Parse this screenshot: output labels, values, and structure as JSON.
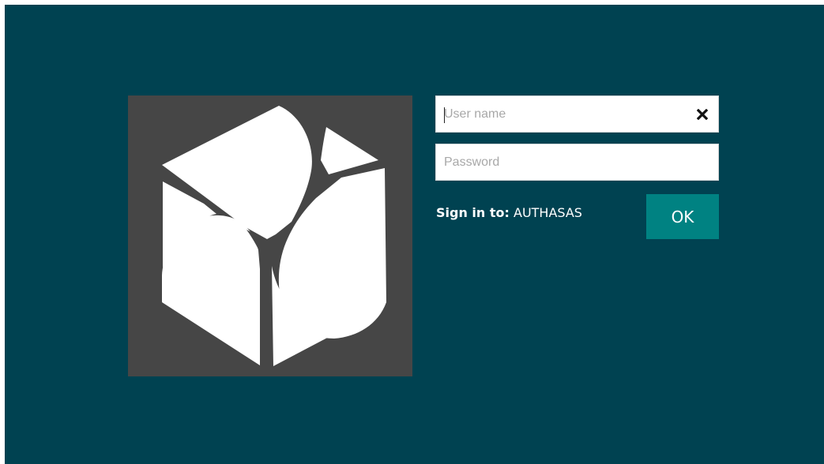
{
  "screen": {
    "background_color": "#004251",
    "accent_color": "#008282"
  },
  "logo": {
    "icon": "hexagon-logo-icon",
    "tile_color": "#464646"
  },
  "login": {
    "username": {
      "placeholder": "User name",
      "value": "",
      "clear_icon": "close-icon"
    },
    "password": {
      "placeholder": "Password",
      "value": ""
    },
    "sign_in_label": "Sign in to:",
    "domain": "AUTHASAS",
    "ok_label": "OK"
  }
}
